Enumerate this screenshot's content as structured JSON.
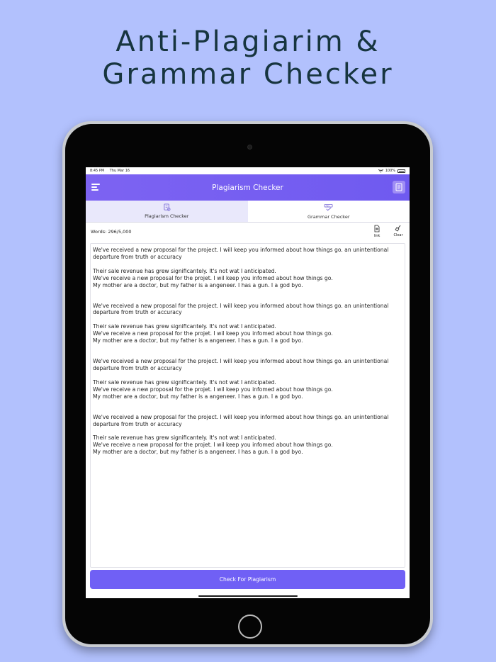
{
  "headline": {
    "line1": "Anti-Plagiarim &",
    "line2": "Grammar Checker"
  },
  "status_bar": {
    "time": "8:45 PM",
    "date": "Thu Mar 16",
    "battery": "100%"
  },
  "nav": {
    "title": "Plagiarism Checker"
  },
  "tabs": [
    {
      "label": "Plagiarism Checker",
      "active": true
    },
    {
      "label": "Grammar Checker",
      "active": false
    }
  ],
  "toolbar": {
    "words": "Words: 296/5,000",
    "link_label": "link",
    "clear_label": "Clear"
  },
  "editor": {
    "paragraphs": [
      " We've received a new proposal for the project. I will keep you informed about how things go. an unintentional\ndeparture from truth or accuracy",
      "Their sale revenue has grew significantely. It's not wat I anticipated.\nWe've receive a new proposal for the projet. I wil keep you infomed about how things go.\nMy mother are a doctor, but my father is a angeneer. I has a gun. I a god byo.",
      "We've received a new proposal for the project. I will keep you informed about how things go. an unintentional\ndeparture from truth or accuracy",
      "Their sale revenue has grew significantely. It's not wat I anticipated.\nWe've receive a new proposal for the projet. I wil keep you infomed about how things go.\nMy mother are a doctor, but my father is a angeneer. I has a gun. I a god byo.",
      "We've received a new proposal for the project. I will keep you informed about how things go. an unintentional\ndeparture from truth or accuracy",
      "Their sale revenue has grew significantely. It's not wat I anticipated.\nWe've receive a new proposal for the projet. I wil keep you infomed about how things go.\nMy mother are a doctor, but my father is a angeneer. I has a gun. I a god byo.",
      "We've received a new proposal for the project. I will keep you informed about how things go. an unintentional\ndeparture from truth or accuracy",
      "Their sale revenue has grew significantely. It's not wat I anticipated.\nWe've receive a new proposal for the projet. I wil keep you infomed about how things go.\nMy mother are a doctor, but my father is a angeneer. I has a gun. I a god byo."
    ]
  },
  "action": {
    "check_label": "Check For Plagiarism"
  },
  "colors": {
    "background": "#b2c1fd",
    "accent": "#7060f5",
    "headline": "#17353f",
    "active_tab": "#e9e8fb"
  }
}
